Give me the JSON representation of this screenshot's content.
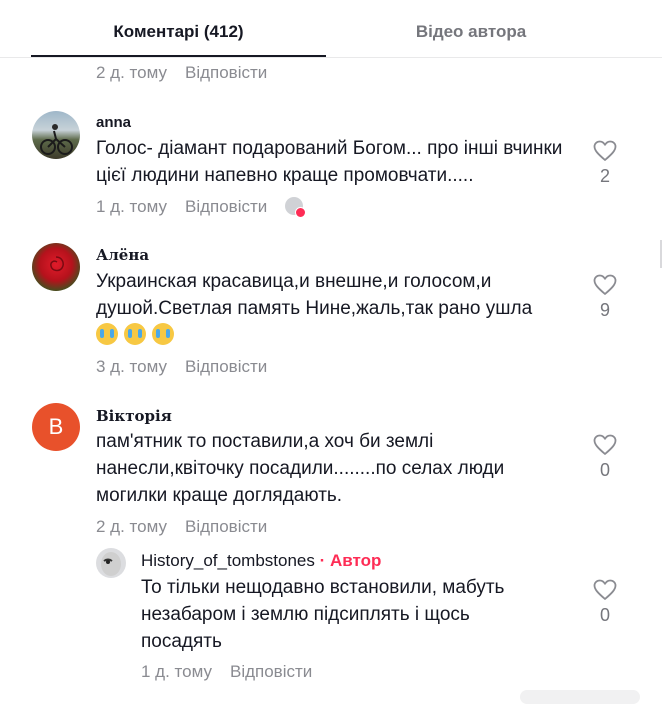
{
  "tabs": {
    "comments": "Коментарі (412)",
    "author_videos": "Відео автора"
  },
  "top_meta": {
    "time": "2 д. тому",
    "reply": "Відповісти"
  },
  "comments": [
    {
      "username": "anna",
      "text": "Голос- діамант подарований Богом... про інші вчинки цієї людини напевно краще промовчати.....",
      "time": "1 д. тому",
      "reply": "Відповісти",
      "likes": "2"
    },
    {
      "username": "Алёна",
      "text": "Украинская красавица,и внешне,и голосом,и душой.Светлая память Нине,жаль,так рано ушла",
      "time": "3 д. тому",
      "reply": "Відповісти",
      "likes": "9"
    },
    {
      "username": "Вікторія",
      "avatar_letter": "B",
      "text": "пам'ятник то поставили,а хоч би землі нанесли,квіточку посадили........по селах люди могилки краще доглядають.",
      "time": "2 д. тому",
      "reply": "Відповісти",
      "likes": "0"
    }
  ],
  "reply_comment": {
    "username": "History_of_tombstones",
    "separator": " · ",
    "badge": "Автор",
    "text": "То тільки нещодавно встановили, мабуть незабаром і землю підсиплять і щось посадять",
    "time": "1 д. тому",
    "reply": "Відповісти",
    "likes": "0"
  },
  "colors": {
    "accent": "#fe2c55",
    "text": "#161823",
    "muted": "#8a8b91",
    "avatar_orange": "#e8512b"
  }
}
